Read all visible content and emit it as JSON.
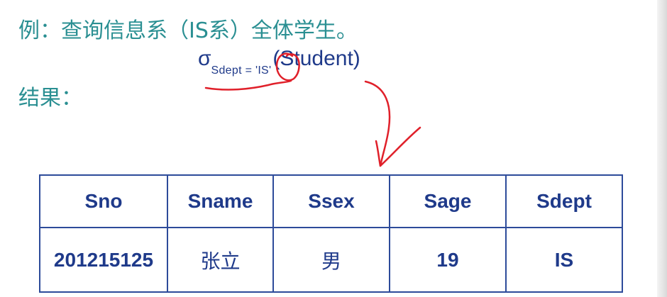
{
  "example": {
    "text": "例：查询信息系（IS系）全体学生。"
  },
  "result": {
    "label": "结果："
  },
  "formula": {
    "sigma": "σ",
    "condition": "Sdept = 'IS'",
    "relation": "(Student)"
  },
  "annotation": {
    "stroke_color": "#e0202a"
  },
  "table": {
    "columns": [
      "Sno",
      "Sname",
      "Ssex",
      "Sage",
      "Sdept"
    ],
    "rows": [
      [
        "201215125",
        "张立",
        "男",
        "19",
        "IS"
      ]
    ]
  }
}
